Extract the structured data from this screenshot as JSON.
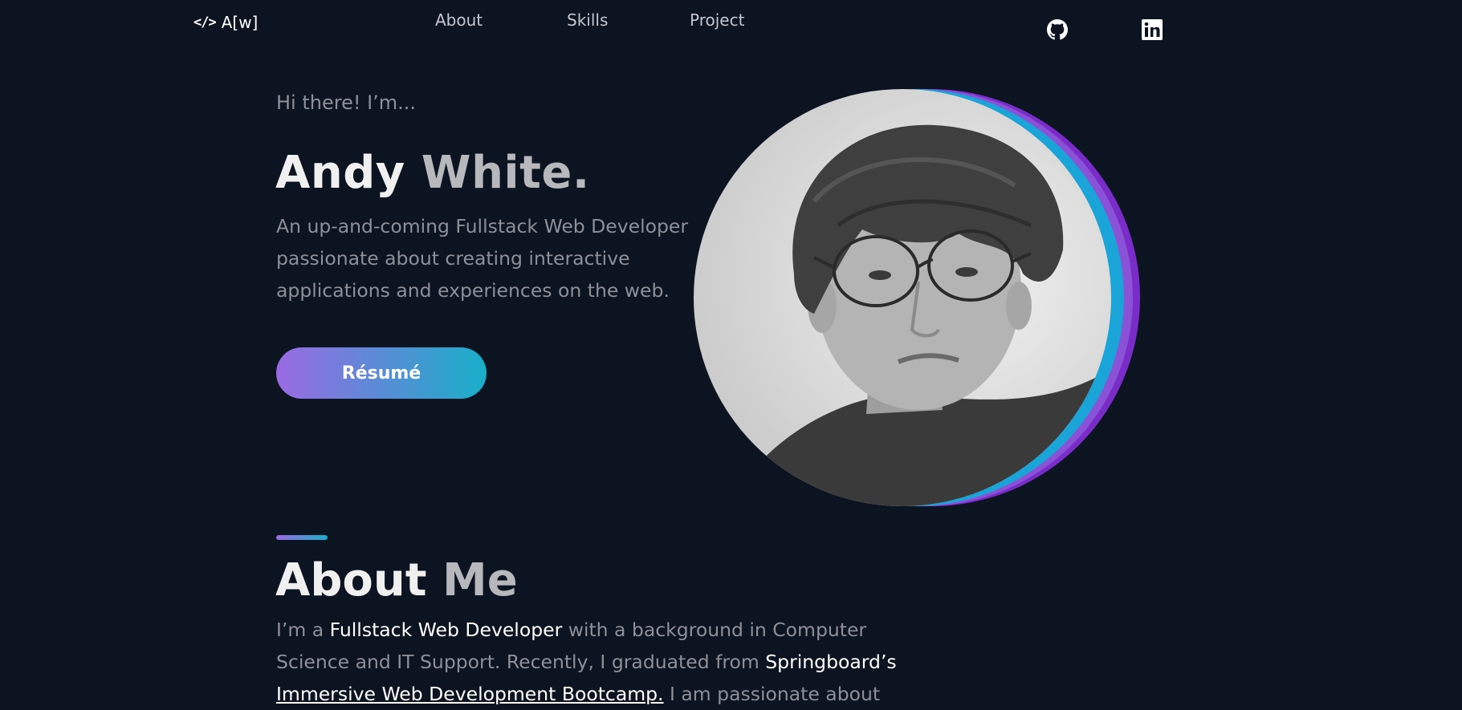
{
  "nav": {
    "logo_icon": "</>",
    "logo_text": "A[w]",
    "links": [
      {
        "label": "About"
      },
      {
        "label": "Skills"
      },
      {
        "label": "Project"
      }
    ],
    "social": [
      {
        "icon": "github-icon"
      },
      {
        "icon": "linkedin-icon"
      }
    ]
  },
  "hero": {
    "greeting": "Hi there! I’m...",
    "first_name": "Andy",
    "last_name": "White.",
    "tagline": "An up-and-coming Fullstack Web Developer passionate about creating interactive applications and experiences on the web.",
    "resume_label": "Résumé"
  },
  "about": {
    "title_1": "About",
    "title_2": "Me",
    "p1": "I’m a ",
    "h1": "Fullstack Web Developer",
    "p2": " with a background in Computer Science and IT Support. Recently, I graduated from ",
    "h2": "Springboard’s",
    "h3": "Immersive Web Development Bootcamp.",
    "p3": " I am passionate about"
  },
  "colors": {
    "background": "#0d1421",
    "accent_purple": "#9a6ae3",
    "accent_cyan": "#18afc9",
    "text_muted": "#8d9096"
  }
}
